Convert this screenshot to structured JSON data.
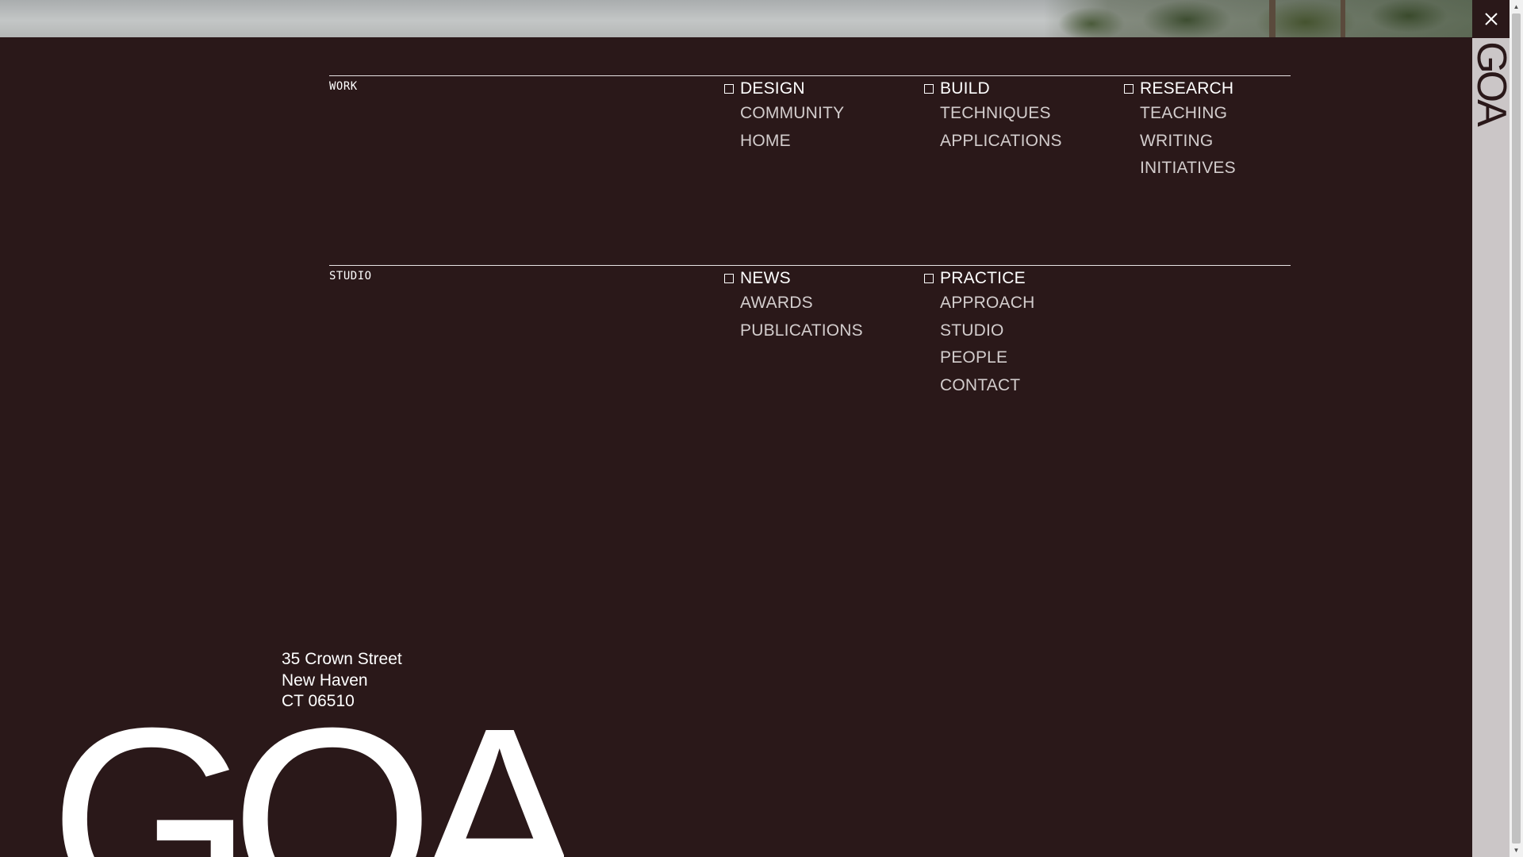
{
  "header": {
    "close_icon": "close-icon",
    "rail_logo": "GOA"
  },
  "sections": [
    {
      "label": "WORK",
      "columns": [
        {
          "heading": "DESIGN",
          "items": [
            "COMMUNITY",
            "HOME"
          ]
        },
        {
          "heading": "BUILD",
          "items": [
            "TECHNIQUES",
            "APPLICATIONS"
          ]
        },
        {
          "heading": "RESEARCH",
          "items": [
            "TEACHING",
            "WRITING",
            "INITIATIVES"
          ]
        }
      ]
    },
    {
      "label": "STUDIO",
      "columns": [
        {
          "heading": "NEWS",
          "items": [
            "AWARDS",
            "PUBLICATIONS"
          ]
        },
        {
          "heading": "PRACTICE",
          "items": [
            "APPROACH",
            "STUDIO",
            "PEOPLE",
            "CONTACT"
          ]
        }
      ]
    }
  ],
  "footer": {
    "address": [
      "35 Crown Street",
      "New Haven",
      "CT 06510"
    ],
    "logo": "GOA"
  },
  "colors": {
    "background": "#2a1819",
    "rail": "#cbc6c7",
    "muted_text": "#d3cdcd"
  }
}
